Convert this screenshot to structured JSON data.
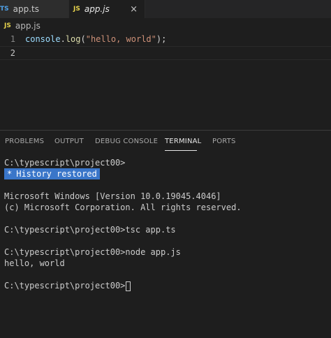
{
  "tabs": [
    {
      "lang": "TS",
      "label": "app.ts"
    },
    {
      "lang": "JS",
      "label": "app.js",
      "close": "×"
    }
  ],
  "breadcrumb": {
    "lang": "JS",
    "label": "app.js"
  },
  "editor": {
    "lines": [
      {
        "num": "1",
        "tokens": {
          "obj": "console",
          "dot": ".",
          "fn": "log",
          "open": "(",
          "str": "\"hello, world\"",
          "close": ");"
        }
      },
      {
        "num": "2"
      }
    ]
  },
  "panel": {
    "tabs": [
      "PROBLEMS",
      "OUTPUT",
      "DEBUG CONSOLE",
      "TERMINAL",
      "PORTS"
    ],
    "active": "TERMINAL"
  },
  "terminal": {
    "line1": "C:\\typescript\\project00>",
    "history_star": "*",
    "history_text": "History restored",
    "line3": "Microsoft Windows [Version 10.0.19045.4046]",
    "line4": "(c) Microsoft Corporation. All rights reserved.",
    "line5": "C:\\typescript\\project00>tsc app.ts",
    "line6": "C:\\typescript\\project00>node app.js",
    "line7": "hello, world",
    "line8": "C:\\typescript\\project00>"
  },
  "colors": {
    "ts": "#4fa1e8",
    "js": "#e8d44d",
    "history_bg": "#3a76c9"
  }
}
